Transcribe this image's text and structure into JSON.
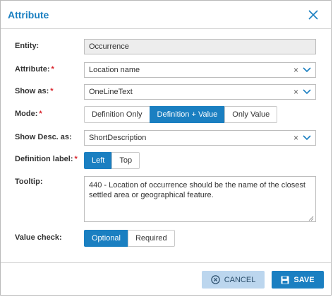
{
  "dialog": {
    "title": "Attribute"
  },
  "fields": {
    "entity": {
      "label": "Entity:",
      "value": "Occurrence"
    },
    "attribute": {
      "label": "Attribute:",
      "required": "*",
      "value": "Location name",
      "clear": "×"
    },
    "show_as": {
      "label": "Show as:",
      "required": "*",
      "value": "OneLineText",
      "clear": "×"
    },
    "mode": {
      "label": "Mode:",
      "required": "*",
      "options": [
        "Definition Only",
        "Definition + Value",
        "Only Value"
      ],
      "selected": "Definition + Value"
    },
    "show_desc": {
      "label": "Show Desc. as:",
      "value": "ShortDescription",
      "clear": "×"
    },
    "definition_label": {
      "label": "Definition label:",
      "required": "*",
      "options": [
        "Left",
        "Top"
      ],
      "selected": "Left"
    },
    "tooltip": {
      "label": "Tooltip:",
      "value": "440 - Location of occurrence should be the name of the closest settled area or geographical feature."
    },
    "value_check": {
      "label": "Value check:",
      "options": [
        "Optional",
        "Required"
      ],
      "selected": "Optional"
    }
  },
  "footer": {
    "cancel_label": "CANCEL",
    "save_label": "SAVE"
  },
  "colors": {
    "accent": "#1a7fc1",
    "required": "#d9222a",
    "cancel_bg": "#bcd6ee"
  },
  "icons": {
    "close": "close-icon",
    "chevron": "chevron-down-icon",
    "cancel": "cancel-circle-icon",
    "save": "floppy-disk-icon"
  }
}
